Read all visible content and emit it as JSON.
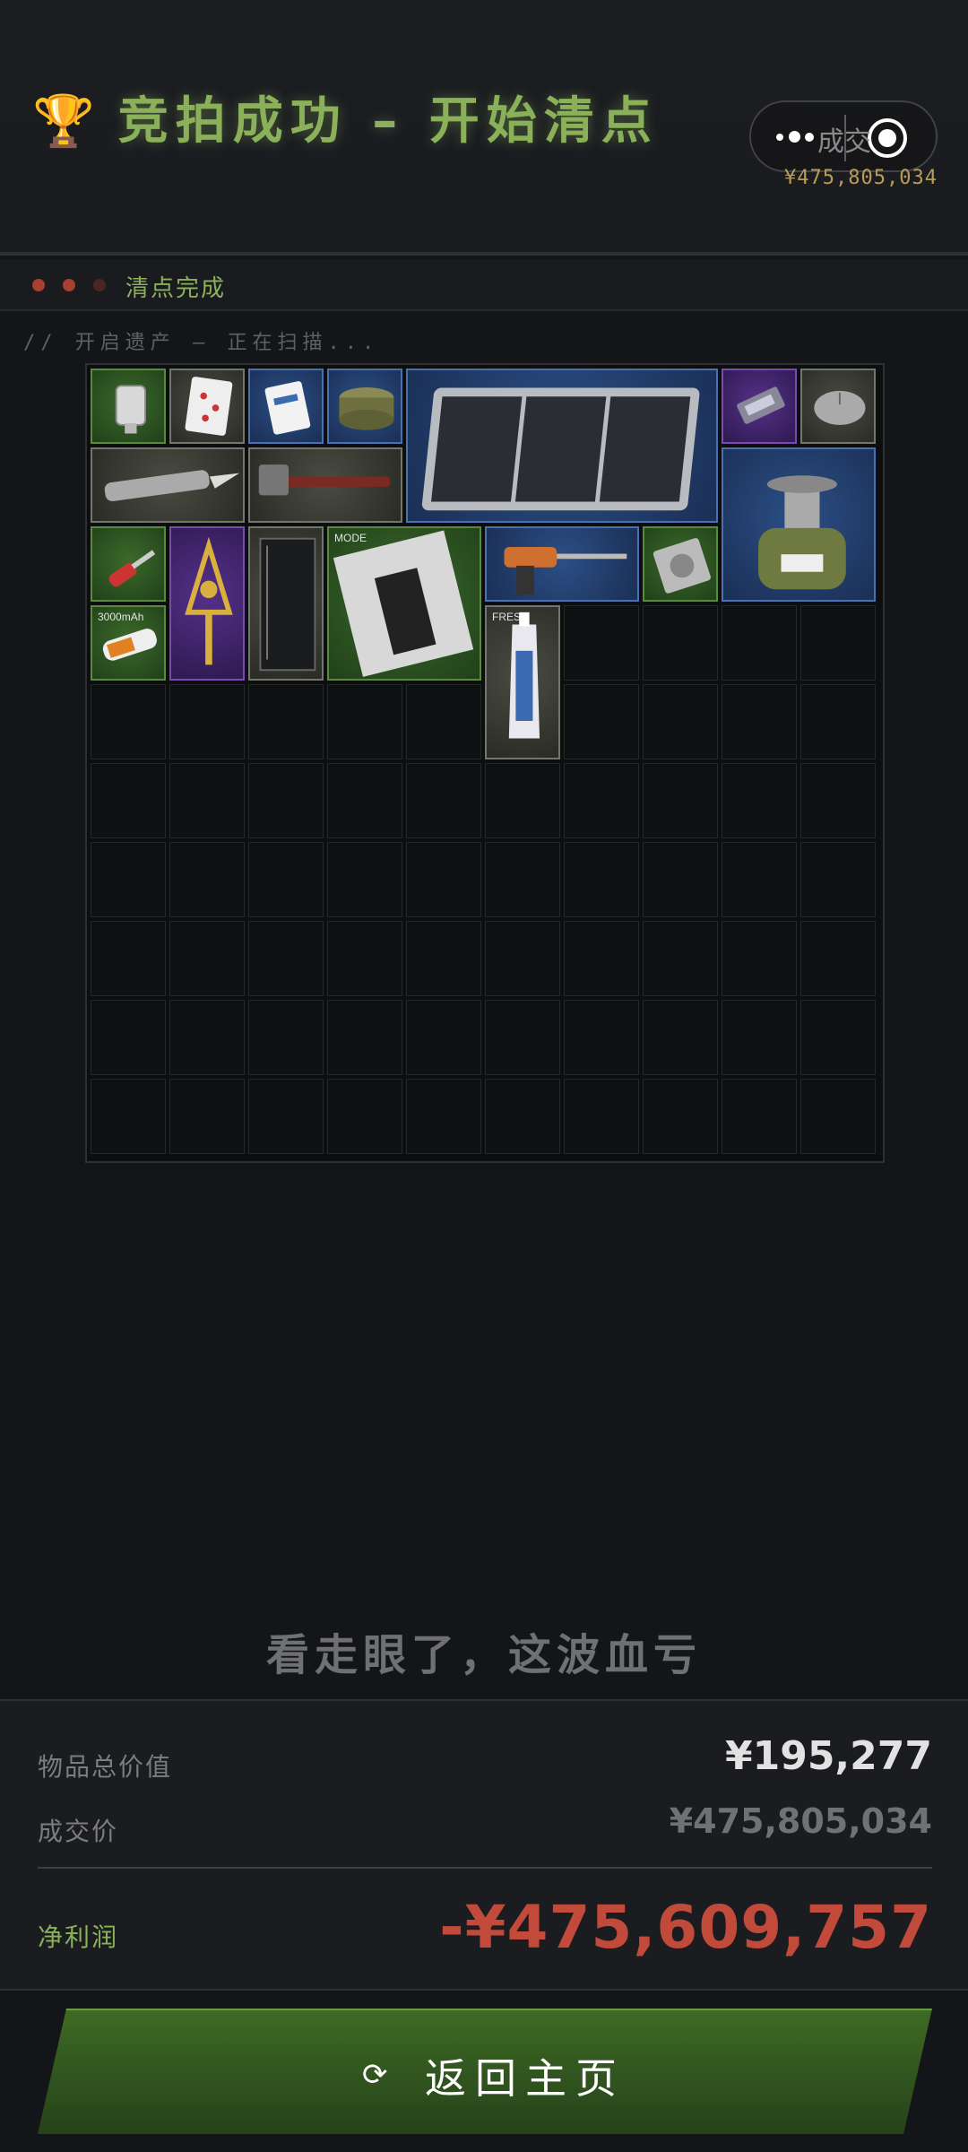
{
  "header": {
    "trophy_icon": "🏆",
    "title": "竞拍成功 – 开始清点",
    "capsule_label": "成交",
    "price": "¥475,805,034"
  },
  "status": {
    "label": "清点完成"
  },
  "scan_text": "// 开启遗产 – 正在扫描...",
  "grid": {
    "rows": 10,
    "cols": 10,
    "items": [
      {
        "name": "iv-bag",
        "col": 0,
        "row": 0,
        "w": 1,
        "h": 1,
        "rarity": "green"
      },
      {
        "name": "playing-card",
        "col": 1,
        "row": 0,
        "w": 1,
        "h": 1,
        "rarity": "gray"
      },
      {
        "name": "sd-card",
        "col": 2,
        "row": 0,
        "w": 1,
        "h": 1,
        "rarity": "blue"
      },
      {
        "name": "ration-tin",
        "col": 3,
        "row": 0,
        "w": 1,
        "h": 1,
        "rarity": "blue"
      },
      {
        "name": "solar-panel",
        "col": 4,
        "row": 0,
        "w": 4,
        "h": 2,
        "rarity": "blue"
      },
      {
        "name": "flash-drive",
        "col": 8,
        "row": 0,
        "w": 1,
        "h": 1,
        "rarity": "purple"
      },
      {
        "name": "computer-mouse",
        "col": 9,
        "row": 0,
        "w": 1,
        "h": 1,
        "rarity": "gray"
      },
      {
        "name": "utility-knife",
        "col": 0,
        "row": 1,
        "w": 2,
        "h": 1,
        "rarity": "gray"
      },
      {
        "name": "hammer",
        "col": 2,
        "row": 1,
        "w": 2,
        "h": 1,
        "rarity": "gray"
      },
      {
        "name": "camping-stove",
        "col": 8,
        "row": 1,
        "w": 2,
        "h": 2,
        "rarity": "blue"
      },
      {
        "name": "screwdriver",
        "col": 0,
        "row": 2,
        "w": 1,
        "h": 1,
        "rarity": "green"
      },
      {
        "name": "gold-emblem",
        "col": 1,
        "row": 2,
        "w": 1,
        "h": 2,
        "rarity": "purple"
      },
      {
        "name": "glass-pane",
        "col": 2,
        "row": 2,
        "w": 1,
        "h": 2,
        "rarity": "gray"
      },
      {
        "name": "magazine",
        "col": 3,
        "row": 2,
        "w": 2,
        "h": 2,
        "rarity": "green"
      },
      {
        "name": "power-drill",
        "col": 5,
        "row": 2,
        "w": 2,
        "h": 1,
        "rarity": "blue"
      },
      {
        "name": "hard-drive",
        "col": 7,
        "row": 2,
        "w": 1,
        "h": 1,
        "rarity": "green"
      },
      {
        "name": "battery",
        "col": 0,
        "row": 3,
        "w": 1,
        "h": 1,
        "rarity": "green"
      },
      {
        "name": "toothpaste",
        "col": 5,
        "row": 3,
        "w": 1,
        "h": 2,
        "rarity": "gray"
      }
    ],
    "item_text": {
      "magazine": "MODE",
      "toothpaste": "FRESH",
      "battery": "3000mAh"
    }
  },
  "verdict": "看走眼了，这波血亏",
  "summary": {
    "total_label": "物品总价值",
    "total_value": "¥195,277",
    "deal_label": "成交价",
    "deal_value": "¥475,805,034",
    "net_label": "净利润",
    "net_value": "-¥475,609,757"
  },
  "button": {
    "icon": "refresh-icon",
    "icon_glyph": "⟳",
    "label": "返回主页"
  },
  "colors": {
    "accent_green": "#8bb05a",
    "loss_red": "#c24a3a",
    "gold": "#b99c58"
  }
}
